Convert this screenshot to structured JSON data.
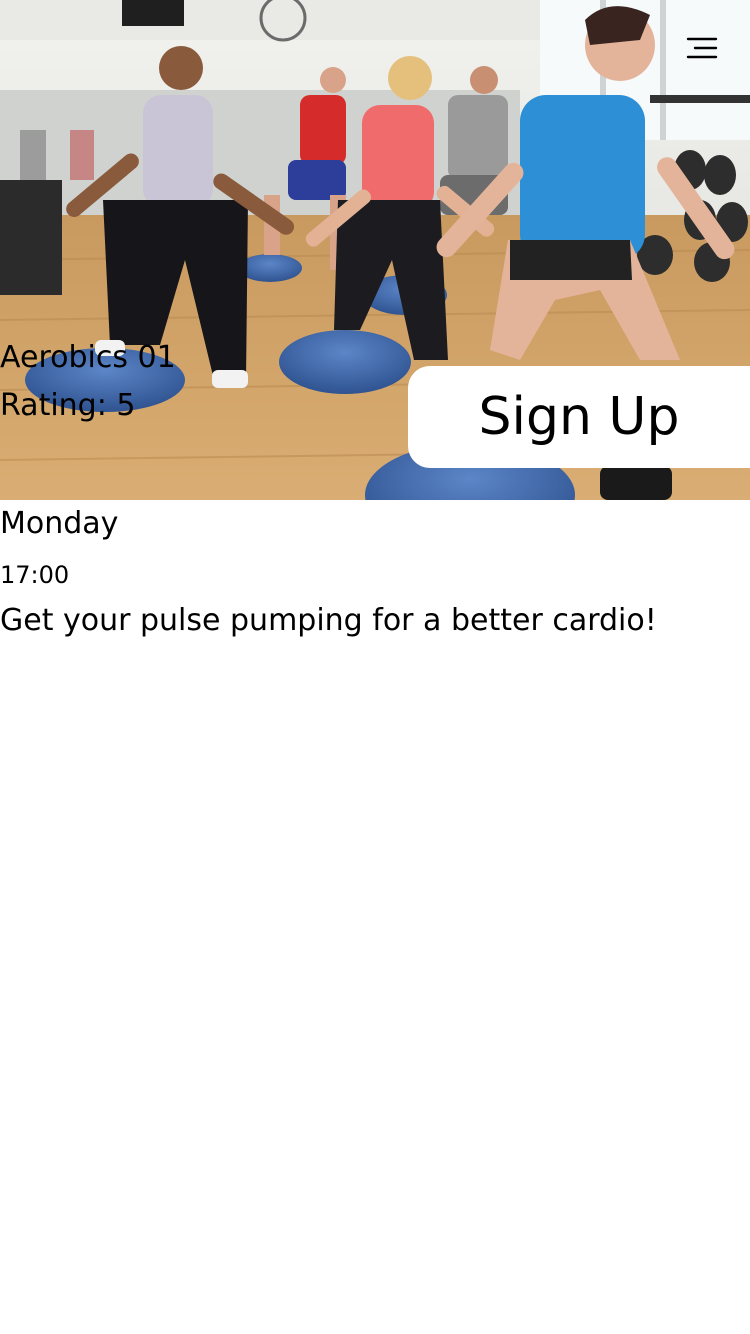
{
  "header": {
    "menu_icon": "hamburger-menu-icon"
  },
  "hero": {
    "image_subject": "gym-class-photo",
    "class_name": "Aerobics 01",
    "rating_text": "Rating: 5",
    "signup_label": "Sign Up"
  },
  "details": {
    "day": "Monday",
    "time": "17:00",
    "description": "Get your pulse pumping for a better cardio!"
  }
}
